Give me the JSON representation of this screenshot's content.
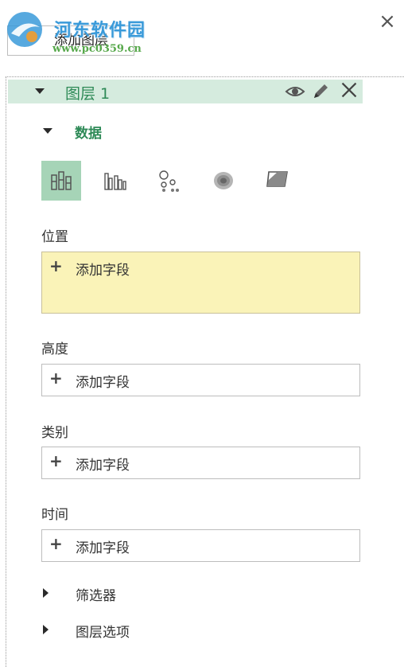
{
  "watermark": {
    "title": "河东软件园",
    "url": "www.pc0359.cn"
  },
  "toolbar": {
    "add_layer_label": "添加图层",
    "close_label": "×"
  },
  "layer": {
    "name": "图层 1",
    "icons": [
      "eye-icon",
      "pencil-icon",
      "close-icon"
    ]
  },
  "data_section": {
    "title": "数据",
    "viz_types": [
      {
        "icon": "stacked-column-icon",
        "selected": true
      },
      {
        "icon": "clustered-column-icon",
        "selected": false
      },
      {
        "icon": "bubble-icon",
        "selected": false
      },
      {
        "icon": "heat-map-icon",
        "selected": false
      },
      {
        "icon": "region-icon",
        "selected": false
      }
    ]
  },
  "fields": [
    {
      "label": "位置",
      "add_text": "添加字段",
      "plus": "+"
    },
    {
      "label": "高度",
      "add_text": "添加字段",
      "plus": "+"
    },
    {
      "label": "类别",
      "add_text": "添加字段",
      "plus": "+"
    },
    {
      "label": "时间",
      "add_text": "添加字段",
      "plus": "+"
    }
  ],
  "collapsibles": [
    {
      "label": "筛选器"
    },
    {
      "label": "图层选项"
    }
  ],
  "colors": {
    "accent_green": "#2e8a57",
    "layer_header_bg": "#d5ebde",
    "selected_viz_bg": "#a6d4b7",
    "location_well_bg": "#faf3b8"
  }
}
